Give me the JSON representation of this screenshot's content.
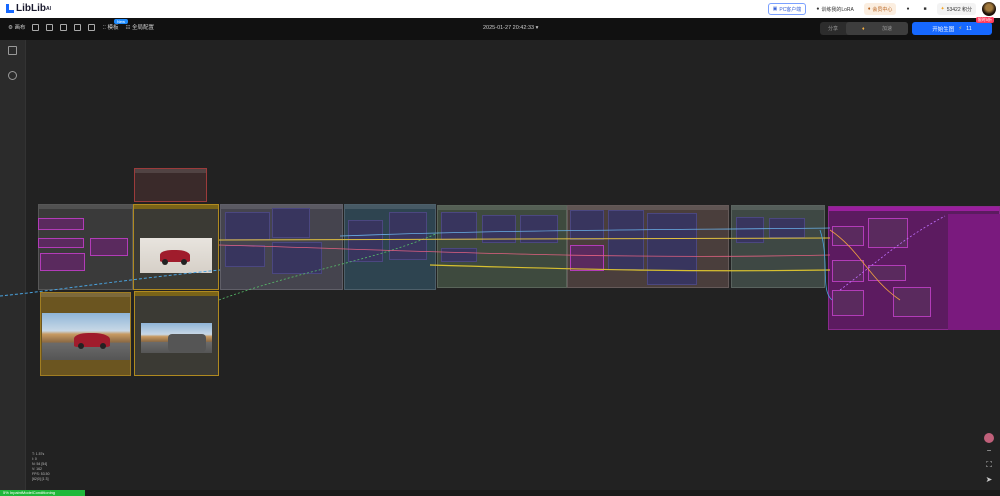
{
  "app": {
    "logo": "LibLib",
    "logo_sup": "AI"
  },
  "topbar": {
    "pc_client": "PC客户端",
    "train_lora": "训练我的LoRA",
    "vip_center": "会员中心",
    "points": "53422 积分"
  },
  "toolbar": {
    "canvas": "画布",
    "new_badge": "New",
    "template": "模板",
    "global_config": "全局配置",
    "timestamp": "2025-01-27 20:42:33",
    "share": "分享",
    "speed": "加速",
    "run_label": "开始生图",
    "run_cost": "11",
    "promo_badge": "限时5折"
  },
  "canvas": {
    "info_lines": [
      "T: 1.57s",
      "I: 0",
      "N: 54 [54]",
      "V: 162",
      "FPS: 53.50",
      "[62|0] [1 3]"
    ]
  },
  "status": {
    "progress_percent": 5,
    "text": "5% InpaintModelConditioning",
    "color": "#1fb83a"
  },
  "colors": {
    "accent": "#1668ff",
    "canvas_bg": "#222222",
    "group_magenta": "#9b1f9e"
  }
}
